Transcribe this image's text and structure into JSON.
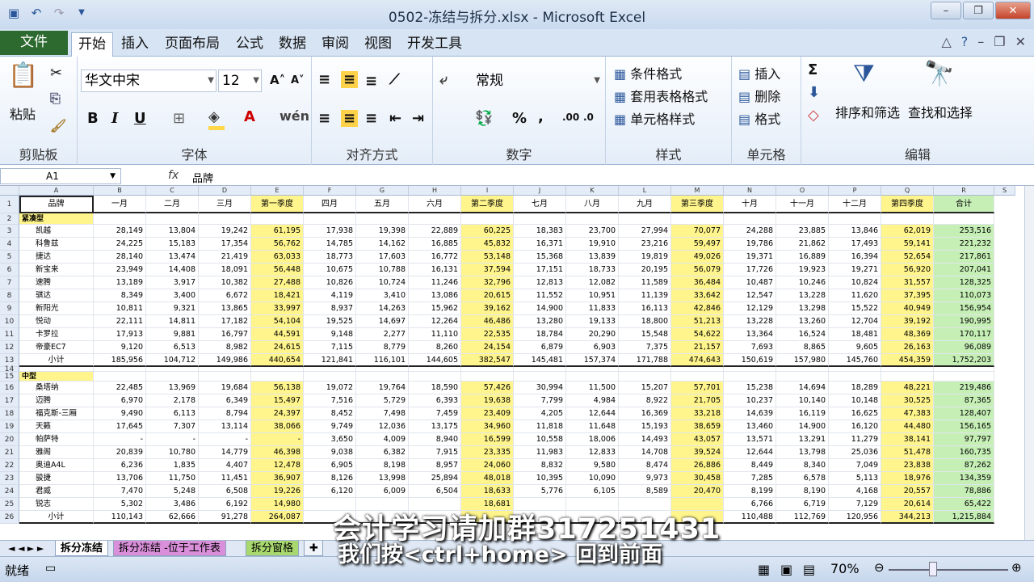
{
  "window": {
    "title": "0502-冻结与拆分.xlsx - Microsoft Excel"
  },
  "tabs": [
    "文件",
    "开始",
    "插入",
    "页面布局",
    "公式",
    "数据",
    "审阅",
    "视图",
    "开发工具"
  ],
  "ribbon": {
    "clipboard": {
      "label": "剪贴板",
      "paste": "粘贴"
    },
    "font": {
      "label": "字体",
      "family": "华文中宋",
      "size": "12",
      "bold": "B",
      "italic": "I",
      "underline": "U"
    },
    "align": {
      "label": "对齐方式"
    },
    "number": {
      "label": "数字",
      "format": "常规",
      "percent": "%"
    },
    "styles": {
      "label": "样式",
      "cond": "条件格式",
      "table": "套用表格格式",
      "cell": "单元格样式"
    },
    "cells": {
      "label": "单元格",
      "insert": "插入",
      "delete": "删除",
      "format": "格式"
    },
    "edit": {
      "label": "编辑",
      "sort": "排序和筛选",
      "find": "查找和选择",
      "sum": "Σ"
    }
  },
  "formula": {
    "cell": "A1",
    "fx": "fx",
    "value": "品牌"
  },
  "columns": [
    "A",
    "B",
    "C",
    "D",
    "E",
    "F",
    "G",
    "H",
    "I",
    "J",
    "K",
    "L",
    "M",
    "N",
    "O",
    "P",
    "Q",
    "R",
    "S"
  ],
  "headers": [
    "品牌",
    "一月",
    "二月",
    "三月",
    "第一季度",
    "四月",
    "五月",
    "六月",
    "第二季度",
    "七月",
    "八月",
    "九月",
    "第三季度",
    "十月",
    "十一月",
    "十二月",
    "第四季度",
    "合计"
  ],
  "rows": [
    {
      "r": "1",
      "type": "header"
    },
    {
      "r": "2",
      "type": "group",
      "label": "紧凑型"
    },
    {
      "r": "3",
      "cells": [
        "凯越",
        "28,149",
        "13,804",
        "19,242",
        "61,195",
        "17,938",
        "19,398",
        "22,889",
        "60,225",
        "18,383",
        "23,700",
        "27,994",
        "70,077",
        "24,288",
        "23,885",
        "13,846",
        "62,019",
        "253,516"
      ]
    },
    {
      "r": "4",
      "cells": [
        "科鲁兹",
        "24,225",
        "15,183",
        "17,354",
        "56,762",
        "14,785",
        "14,162",
        "16,885",
        "45,832",
        "16,371",
        "19,910",
        "23,216",
        "59,497",
        "19,786",
        "21,862",
        "17,493",
        "59,141",
        "221,232"
      ]
    },
    {
      "r": "5",
      "cells": [
        "捷达",
        "28,140",
        "13,474",
        "21,419",
        "63,033",
        "18,773",
        "17,603",
        "16,772",
        "53,148",
        "15,368",
        "13,839",
        "19,819",
        "49,026",
        "19,371",
        "16,889",
        "16,394",
        "52,654",
        "217,861"
      ]
    },
    {
      "r": "6",
      "cells": [
        "新宝来",
        "23,949",
        "14,408",
        "18,091",
        "56,448",
        "10,675",
        "10,788",
        "16,131",
        "37,594",
        "17,151",
        "18,733",
        "20,195",
        "56,079",
        "17,726",
        "19,923",
        "19,271",
        "56,920",
        "207,041"
      ]
    },
    {
      "r": "7",
      "cells": [
        "速腾",
        "13,189",
        "3,917",
        "10,382",
        "27,488",
        "10,826",
        "10,724",
        "11,246",
        "32,796",
        "12,813",
        "12,082",
        "11,589",
        "36,484",
        "10,487",
        "10,246",
        "10,824",
        "31,557",
        "128,325"
      ]
    },
    {
      "r": "8",
      "cells": [
        "骐达",
        "8,349",
        "3,400",
        "6,672",
        "18,421",
        "4,119",
        "3,410",
        "13,086",
        "20,615",
        "11,552",
        "10,951",
        "11,139",
        "33,642",
        "12,547",
        "13,228",
        "11,620",
        "37,395",
        "110,073"
      ]
    },
    {
      "r": "9",
      "cells": [
        "新阳光",
        "10,811",
        "9,321",
        "13,865",
        "33,997",
        "8,937",
        "14,263",
        "15,962",
        "39,162",
        "14,900",
        "11,833",
        "16,113",
        "42,846",
        "12,129",
        "13,298",
        "15,522",
        "40,949",
        "156,954"
      ]
    },
    {
      "r": "10",
      "cells": [
        "悦动",
        "22,111",
        "14,811",
        "17,182",
        "54,104",
        "19,525",
        "14,697",
        "12,264",
        "46,486",
        "13,280",
        "19,133",
        "18,800",
        "51,213",
        "13,228",
        "13,260",
        "12,704",
        "39,192",
        "190,995"
      ]
    },
    {
      "r": "11",
      "cells": [
        "卡罗拉",
        "17,913",
        "9,881",
        "16,797",
        "44,591",
        "9,148",
        "2,277",
        "11,110",
        "22,535",
        "18,784",
        "20,290",
        "15,548",
        "54,622",
        "13,364",
        "16,524",
        "18,481",
        "48,369",
        "170,117"
      ]
    },
    {
      "r": "12",
      "cells": [
        "帝豪EC7",
        "9,120",
        "6,513",
        "8,982",
        "24,615",
        "7,115",
        "8,779",
        "8,260",
        "24,154",
        "6,879",
        "6,903",
        "7,375",
        "21,157",
        "7,693",
        "8,865",
        "9,605",
        "26,163",
        "96,089"
      ]
    },
    {
      "r": "13",
      "type": "subtotal",
      "cells": [
        "小计",
        "185,956",
        "104,712",
        "149,986",
        "440,654",
        "121,841",
        "116,101",
        "144,605",
        "382,547",
        "145,481",
        "157,374",
        "171,788",
        "474,643",
        "150,619",
        "157,980",
        "145,760",
        "454,359",
        "1,752,203"
      ]
    },
    {
      "r": "14",
      "type": "blank"
    },
    {
      "r": "15",
      "type": "group",
      "label": "中型"
    },
    {
      "r": "16",
      "cells": [
        "桑塔纳",
        "22,485",
        "13,969",
        "19,684",
        "56,138",
        "19,072",
        "19,764",
        "18,590",
        "57,426",
        "30,994",
        "11,500",
        "15,207",
        "57,701",
        "15,238",
        "14,694",
        "18,289",
        "48,221",
        "219,486"
      ]
    },
    {
      "r": "17",
      "cells": [
        "迈腾",
        "6,970",
        "2,178",
        "6,349",
        "15,497",
        "7,516",
        "5,729",
        "6,393",
        "19,638",
        "7,799",
        "4,984",
        "8,922",
        "21,705",
        "10,237",
        "10,140",
        "10,148",
        "30,525",
        "87,365"
      ]
    },
    {
      "r": "18",
      "cells": [
        "福克斯-三厢",
        "9,490",
        "6,113",
        "8,794",
        "24,397",
        "8,452",
        "7,498",
        "7,459",
        "23,409",
        "4,205",
        "12,644",
        "16,369",
        "33,218",
        "14,639",
        "16,119",
        "16,625",
        "47,383",
        "128,407"
      ]
    },
    {
      "r": "19",
      "cells": [
        "天籁",
        "17,645",
        "7,307",
        "13,114",
        "38,066",
        "9,749",
        "12,036",
        "13,175",
        "34,960",
        "11,818",
        "11,648",
        "15,193",
        "38,659",
        "13,460",
        "14,900",
        "16,120",
        "44,480",
        "156,165"
      ]
    },
    {
      "r": "20",
      "cells": [
        "帕萨特",
        "-",
        "-",
        "-",
        "-",
        "3,650",
        "4,009",
        "8,940",
        "16,599",
        "10,558",
        "18,006",
        "14,493",
        "43,057",
        "13,571",
        "13,291",
        "11,279",
        "38,141",
        "97,797"
      ]
    },
    {
      "r": "21",
      "cells": [
        "雅阁",
        "20,839",
        "10,780",
        "14,779",
        "46,398",
        "9,038",
        "6,382",
        "7,915",
        "23,335",
        "11,983",
        "12,833",
        "14,708",
        "39,524",
        "12,644",
        "13,798",
        "25,036",
        "51,478",
        "160,735"
      ]
    },
    {
      "r": "22",
      "cells": [
        "奥迪A4L",
        "6,236",
        "1,835",
        "4,407",
        "12,478",
        "6,905",
        "8,198",
        "8,957",
        "24,060",
        "8,832",
        "9,580",
        "8,474",
        "26,886",
        "8,449",
        "8,340",
        "7,049",
        "23,838",
        "87,262"
      ]
    },
    {
      "r": "23",
      "cells": [
        "骏捷",
        "13,706",
        "11,750",
        "11,451",
        "36,907",
        "8,126",
        "13,998",
        "25,894",
        "48,018",
        "10,395",
        "10,090",
        "9,973",
        "30,458",
        "7,285",
        "6,578",
        "5,113",
        "18,976",
        "134,359"
      ]
    },
    {
      "r": "24",
      "cells": [
        "君威",
        "7,470",
        "5,248",
        "6,508",
        "19,226",
        "6,120",
        "6,009",
        "6,504",
        "18,633",
        "5,776",
        "6,105",
        "8,589",
        "20,470",
        "8,199",
        "8,190",
        "4,168",
        "20,557",
        "78,886"
      ]
    },
    {
      "r": "25",
      "cells": [
        "锐志",
        "5,302",
        "3,486",
        "6,192",
        "14,980",
        "",
        "",
        "",
        "18,681",
        "",
        "",
        "",
        "",
        "6,766",
        "6,719",
        "7,129",
        "20,614",
        "65,422"
      ]
    },
    {
      "r": "26",
      "type": "subtotal",
      "cells": [
        "小计",
        "110,143",
        "62,666",
        "91,278",
        "264,087",
        "",
        "",
        "",
        "",
        "",
        "",
        "",
        "",
        "110,488",
        "112,769",
        "120,956",
        "344,213",
        "1,215,884"
      ]
    }
  ],
  "sheets": [
    "拆分冻结",
    "拆分冻结 -位于工作表",
    "拆分窗格"
  ],
  "status": {
    "ready": "就绪",
    "zoom": "70%"
  },
  "overlay": {
    "line1": "会计学习请加群317251431",
    "line2": "我们按<ctrl+home> 回到前面"
  }
}
